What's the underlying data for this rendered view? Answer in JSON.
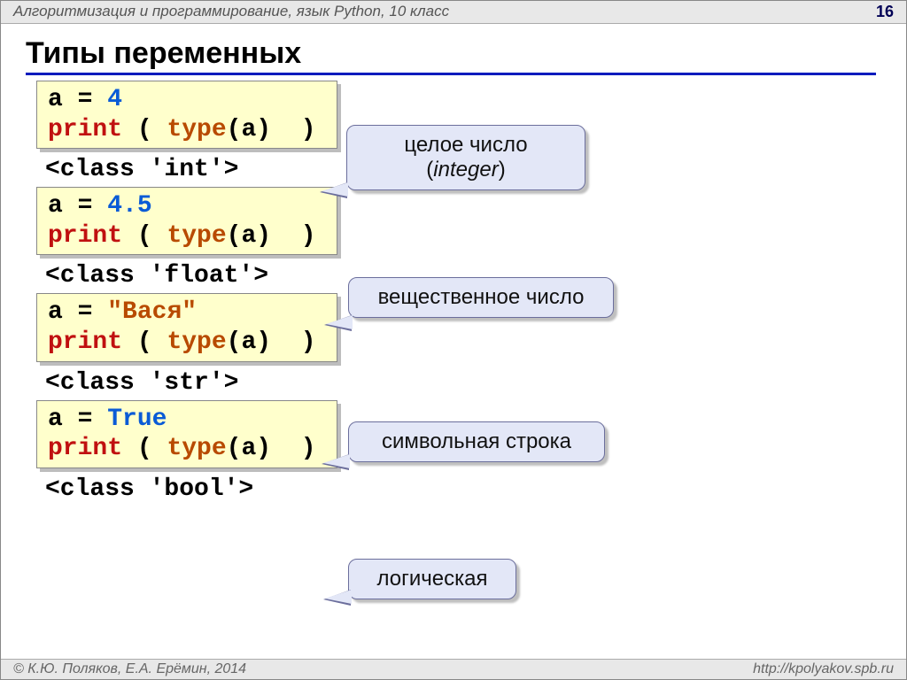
{
  "header": {
    "subject": "Алгоритмизация и программирование, язык Python, 10 класс",
    "page": "16"
  },
  "title": "Типы переменных",
  "blocks": [
    {
      "assign_var": "a",
      "assign_op": "=",
      "assign_val": "4",
      "val_kind": "num",
      "print_fn": "print",
      "type_fn": "type",
      "arg": "a",
      "output": "<class 'int'>",
      "callout_l1": "целое число",
      "callout_l2a": "(",
      "callout_l2b": "integer",
      "callout_l2c": ")"
    },
    {
      "assign_var": "a",
      "assign_op": "=",
      "assign_val": "4.5",
      "val_kind": "num",
      "print_fn": "print",
      "type_fn": "type",
      "arg": "a",
      "output": "<class 'float'>",
      "callout_l1": "вещественное число"
    },
    {
      "assign_var": "a",
      "assign_op": "=",
      "assign_val": "\"Вася\"",
      "val_kind": "str",
      "print_fn": "print",
      "type_fn": "type",
      "arg": "a",
      "output": "<class 'str'>",
      "callout_l1": "символьная строка"
    },
    {
      "assign_var": "a",
      "assign_op": "=",
      "assign_val": "True",
      "val_kind": "num",
      "print_fn": "print",
      "type_fn": "type",
      "arg": "a",
      "output": "<class 'bool'>",
      "callout_l1": "логическая"
    }
  ],
  "footer": {
    "copyright": "© К.Ю. Поляков, Е.А. Ерёмин, 2014",
    "url": "http://kpolyakov.spb.ru"
  }
}
